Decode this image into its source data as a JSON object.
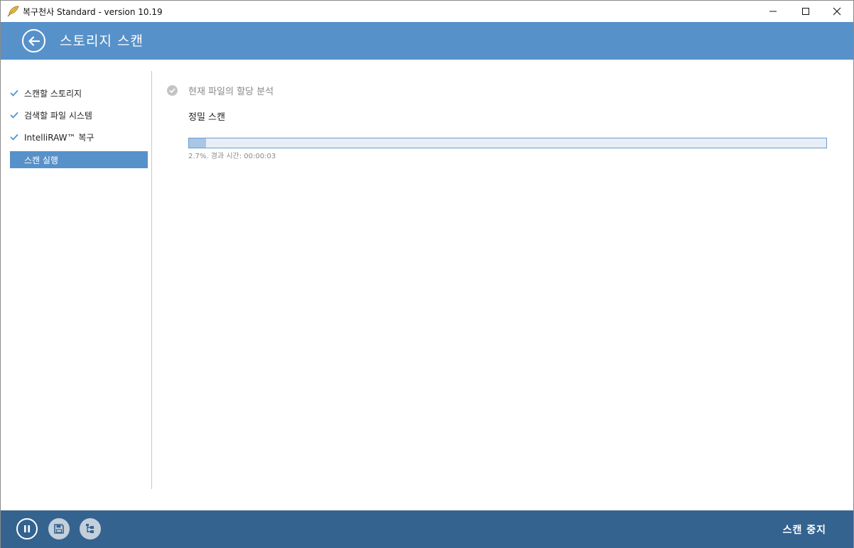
{
  "window": {
    "title": "복구천사 Standard - version 10.19",
    "icons": {
      "app": "feather-icon",
      "minimize": "minimize-icon",
      "maximize": "maximize-icon",
      "close": "close-icon"
    }
  },
  "header": {
    "title": "스토리지 스캔",
    "back_icon": "arrow-left-icon",
    "background": "#5791c9"
  },
  "sidebar": {
    "items": [
      {
        "label": "스캔할 스토리지",
        "state": "done"
      },
      {
        "label": "검색할 파일 시스템",
        "state": "done"
      },
      {
        "label": "IntelliRAW™ 복구",
        "state": "done"
      },
      {
        "label": "스캔 실행",
        "state": "active"
      }
    ],
    "accent": "#5791c9"
  },
  "main": {
    "step_label": "현재 파일의 할당 분석",
    "phase_title": "정밀 스캔",
    "progress_percent": 2.7,
    "progress_text": "2.7%. 경과 시간: 00:00:03"
  },
  "footer": {
    "background": "#356390",
    "buttons": {
      "pause": "pause-icon",
      "save": "floppy-disk-icon",
      "tree": "tree-view-icon"
    },
    "stop_label": "스캔 중지"
  }
}
